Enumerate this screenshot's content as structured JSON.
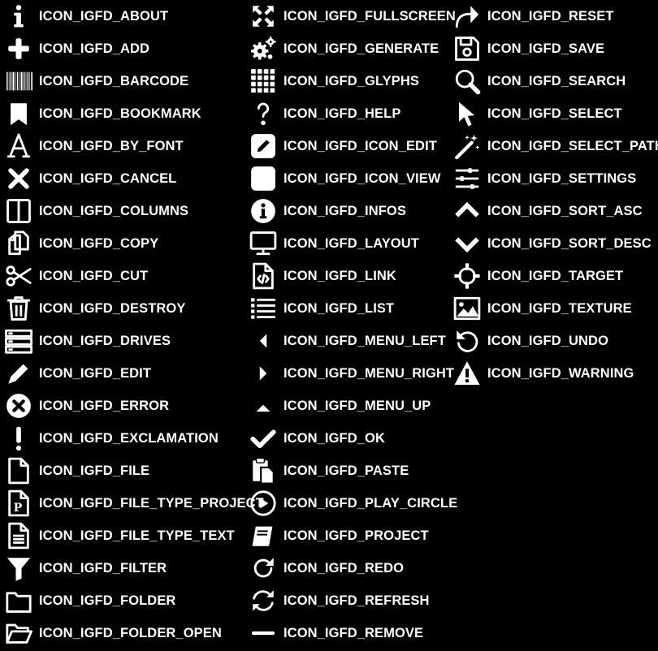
{
  "columns": [
    {
      "items": [
        {
          "label": "ICON_IGFD_ABOUT",
          "icon": "about-icon"
        },
        {
          "label": "ICON_IGFD_ADD",
          "icon": "add-icon"
        },
        {
          "label": "ICON_IGFD_BARCODE",
          "icon": "barcode-icon"
        },
        {
          "label": "ICON_IGFD_BOOKMARK",
          "icon": "bookmark-icon"
        },
        {
          "label": "ICON_IGFD_BY_FONT",
          "icon": "by-font-icon"
        },
        {
          "label": "ICON_IGFD_CANCEL",
          "icon": "cancel-icon"
        },
        {
          "label": "ICON_IGFD_COLUMNS",
          "icon": "columns-icon"
        },
        {
          "label": "ICON_IGFD_COPY",
          "icon": "copy-icon"
        },
        {
          "label": "ICON_IGFD_CUT",
          "icon": "cut-icon"
        },
        {
          "label": "ICON_IGFD_DESTROY",
          "icon": "destroy-icon"
        },
        {
          "label": "ICON_IGFD_DRIVES",
          "icon": "drives-icon"
        },
        {
          "label": "ICON_IGFD_EDIT",
          "icon": "edit-icon"
        },
        {
          "label": "ICON_IGFD_ERROR",
          "icon": "error-icon"
        },
        {
          "label": "ICON_IGFD_EXCLAMATION",
          "icon": "exclamation-icon"
        },
        {
          "label": "ICON_IGFD_FILE",
          "icon": "file-icon"
        },
        {
          "label": "ICON_IGFD_FILE_TYPE_PROJECT",
          "icon": "file-type-project-icon"
        },
        {
          "label": "ICON_IGFD_FILE_TYPE_TEXT",
          "icon": "file-type-text-icon"
        },
        {
          "label": "ICON_IGFD_FILTER",
          "icon": "filter-icon"
        },
        {
          "label": "ICON_IGFD_FOLDER",
          "icon": "folder-icon"
        },
        {
          "label": "ICON_IGFD_FOLDER_OPEN",
          "icon": "folder-open-icon"
        }
      ]
    },
    {
      "items": [
        {
          "label": "ICON_IGFD_FULLSCREEN",
          "icon": "fullscreen-icon"
        },
        {
          "label": "ICON_IGFD_GENERATE",
          "icon": "generate-icon"
        },
        {
          "label": "ICON_IGFD_GLYPHS",
          "icon": "glyphs-icon"
        },
        {
          "label": "ICON_IGFD_HELP",
          "icon": "help-icon"
        },
        {
          "label": "ICON_IGFD_ICON_EDIT",
          "icon": "icon-edit-icon"
        },
        {
          "label": "ICON_IGFD_ICON_VIEW",
          "icon": "icon-view-icon"
        },
        {
          "label": "ICON_IGFD_INFOS",
          "icon": "infos-icon"
        },
        {
          "label": "ICON_IGFD_LAYOUT",
          "icon": "layout-icon"
        },
        {
          "label": "ICON_IGFD_LINK",
          "icon": "link-icon"
        },
        {
          "label": "ICON_IGFD_LIST",
          "icon": "list-icon"
        },
        {
          "label": "ICON_IGFD_MENU_LEFT",
          "icon": "menu-left-icon"
        },
        {
          "label": "ICON_IGFD_MENU_RIGHT",
          "icon": "menu-right-icon"
        },
        {
          "label": "ICON_IGFD_MENU_UP",
          "icon": "menu-up-icon"
        },
        {
          "label": "ICON_IGFD_OK",
          "icon": "ok-icon"
        },
        {
          "label": "ICON_IGFD_PASTE",
          "icon": "paste-icon"
        },
        {
          "label": "ICON_IGFD_PLAY_CIRCLE",
          "icon": "play-circle-icon"
        },
        {
          "label": "ICON_IGFD_PROJECT",
          "icon": "project-icon"
        },
        {
          "label": "ICON_IGFD_REDO",
          "icon": "redo-icon"
        },
        {
          "label": "ICON_IGFD_REFRESH",
          "icon": "refresh-icon"
        },
        {
          "label": "ICON_IGFD_REMOVE",
          "icon": "remove-icon"
        }
      ]
    },
    {
      "items": [
        {
          "label": "ICON_IGFD_RESET",
          "icon": "reset-icon"
        },
        {
          "label": "ICON_IGFD_SAVE",
          "icon": "save-icon"
        },
        {
          "label": "ICON_IGFD_SEARCH",
          "icon": "search-icon"
        },
        {
          "label": "ICON_IGFD_SELECT",
          "icon": "select-icon"
        },
        {
          "label": "ICON_IGFD_SELECT_PATH",
          "icon": "select-path-icon"
        },
        {
          "label": "ICON_IGFD_SETTINGS",
          "icon": "settings-icon"
        },
        {
          "label": "ICON_IGFD_SORT_ASC",
          "icon": "sort-asc-icon"
        },
        {
          "label": "ICON_IGFD_SORT_DESC",
          "icon": "sort-desc-icon"
        },
        {
          "label": "ICON_IGFD_TARGET",
          "icon": "target-icon"
        },
        {
          "label": "ICON_IGFD_TEXTURE",
          "icon": "texture-icon"
        },
        {
          "label": "ICON_IGFD_UNDO",
          "icon": "undo-icon"
        },
        {
          "label": "ICON_IGFD_WARNING",
          "icon": "warning-icon"
        }
      ]
    }
  ],
  "colors": {
    "background": "#000000",
    "foreground": "#ffffff"
  }
}
